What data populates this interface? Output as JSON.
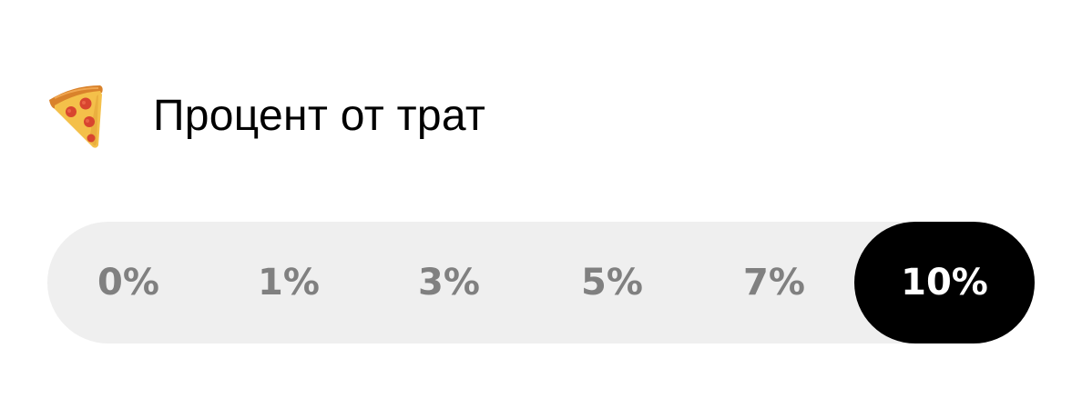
{
  "header": {
    "icon": "pizza-icon",
    "title": "Процент от трат"
  },
  "percent_selector": {
    "options": [
      {
        "label": "0%",
        "value": 0,
        "selected": false
      },
      {
        "label": "1%",
        "value": 1,
        "selected": false
      },
      {
        "label": "3%",
        "value": 3,
        "selected": false
      },
      {
        "label": "5%",
        "value": 5,
        "selected": false
      },
      {
        "label": "7%",
        "value": 7,
        "selected": false
      },
      {
        "label": "10%",
        "value": 10,
        "selected": true
      }
    ],
    "selected_value": 10
  },
  "colors": {
    "selector_background": "#efefef",
    "selected_background": "#000000",
    "selected_text": "#ffffff",
    "unselected_text": "#808080",
    "title_text": "#000000"
  }
}
